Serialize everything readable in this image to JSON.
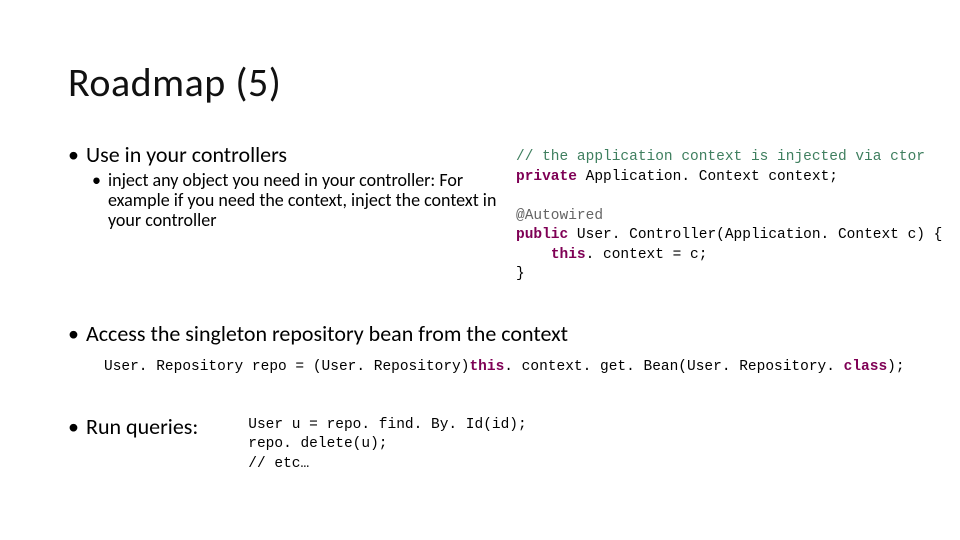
{
  "title": "Roadmap (5)",
  "bullets": {
    "b1": "Use in your controllers",
    "b1_1": "inject any object you need in your controller: For example if you need the context, inject the context in your controller",
    "b2": "Access the singleton repository bean from the context",
    "b3": "Run queries:"
  },
  "code1": {
    "comment": "// the application context is injected via ctor",
    "kw_private": "private",
    "line1_rest": " Application. Context ",
    "line1_var": "context; ",
    "anno": "@Autowired",
    "kw_public": "public",
    "line3_rest": " User. Controller(Application. Context c) {",
    "kw_this": "this",
    "line4_rest": ". context = c; ",
    "line5": "}"
  },
  "code2": {
    "full_pre": "User. Repository repo = (User. Repository)",
    "kw_this": "this",
    "full_post": ". context. get. Bean(User. Repository. ",
    "kw_class": "class",
    "full_end": "); "
  },
  "code3": {
    "l1": "User u = repo. find. By. Id(id); ",
    "l2": "repo. delete(u); ",
    "l3": "// etc…"
  }
}
